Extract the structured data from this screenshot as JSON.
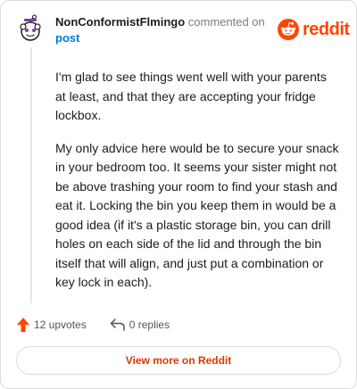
{
  "comment": {
    "author": "NonConformistFlmingo",
    "action": " commented on",
    "target_link": "post",
    "paragraphs": [
      "I'm glad to see things went well with your parents at least, and that they are accepting your fridge lockbox.",
      "My only advice here would be to secure your snack in your bedroom too. It seems your sister might not be above trashing your room to find your stash and eat it. Locking the bin you keep them in would be a good idea (if it's a plastic storage bin, you can drill holes on each side of the lid and through the bin itself that will align, and just put a combination or key lock in each)."
    ]
  },
  "brand": {
    "wordmark": "reddit",
    "icon": "reddit-snoo-icon",
    "color": "#ff4500"
  },
  "footer": {
    "upvotes_label": "12 upvotes",
    "upvote_icon": "upvote-arrow-icon",
    "upvote_color": "#ff4500",
    "replies_label": "0 replies",
    "reply_icon": "reply-arrow-icon",
    "view_more_label": "View more on Reddit"
  },
  "colors": {
    "link": "#0079d3",
    "view_more": "#d93a00"
  }
}
